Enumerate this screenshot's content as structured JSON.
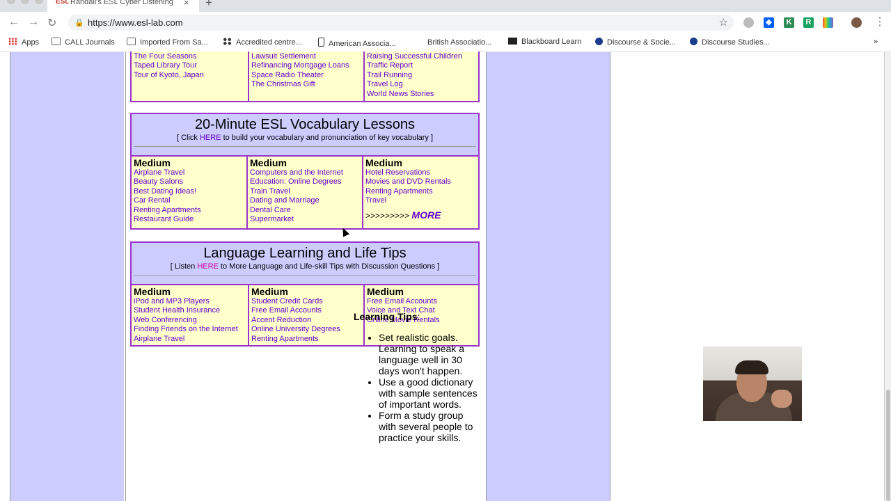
{
  "browser": {
    "tab_title": "Randall's ESL Cyber Listening",
    "tab_favicon": "ESL",
    "url": "https://www.esl-lab.com",
    "bookmarks": [
      "Apps",
      "CALL Journals",
      "Imported From Sa...",
      "Accredited centre...",
      "American Associa...",
      "British Associatio...",
      "Blackboard Learn",
      "Discourse & Socie...",
      "Discourse Studies..."
    ],
    "bookmarks_overflow": "»"
  },
  "top_box": {
    "col1": [
      "The Four Seasons",
      "Taped Library Tour",
      "Tour of Kyoto, Japan"
    ],
    "col2": [
      "Lawsuit Settlement",
      "Refinancing Mortgage Loans",
      "Space Radio Theater",
      "The Christmas Gift"
    ],
    "col3": [
      "Raising Successful Children",
      "Traffic Report",
      "Trail Running",
      "Travel Log",
      "World News Stories"
    ]
  },
  "vocab": {
    "title": "20-Minute ESL Vocabulary Lessons",
    "sub_pre": "[ Click ",
    "sub_link": "HERE",
    "sub_post": " to build your vocabulary and pronunciation of key vocabulary ]",
    "level": "Medium",
    "col1": [
      "Airplane Travel",
      "Beauty Salons",
      "Best Dating Ideas!",
      "Car Rental",
      "Renting Apartments",
      "Restaurant Guide"
    ],
    "col2": [
      "Computers and the Internet",
      "Education: Online Degrees",
      "Train Travel",
      "Dating and Marriage",
      "Dental Care",
      "Supermarket"
    ],
    "col3": [
      "Hotel Reservations",
      "Movies and DVD Rentals",
      "Renting Apartments",
      "Travel"
    ],
    "more_arrows": ">>>>>>>>>",
    "more_label": "MORE"
  },
  "tips_box": {
    "title": "Language Learning and Life Tips",
    "sub_pre": "[ Listen ",
    "sub_link": "HERE",
    "sub_post": " to More Language and Life-skill Tips with Discussion Questions ]",
    "level": "Medium",
    "col1": [
      "iPod and MP3 Players",
      "Student Health Insurance",
      "Web Conferencing",
      "Finding Friends on the Internet",
      "Airplane Travel"
    ],
    "col2": [
      "Student Credit Cards",
      "Free Email Accounts",
      "Accent Reduction",
      "Online University Degrees",
      "Renting Apartments"
    ],
    "col3": [
      "Free Email Accounts",
      "Voice and Text Chat",
      "Online Movie Rentals"
    ]
  },
  "learning_tips": {
    "title": "Learning Tips",
    "colon": ":",
    "items": [
      "Set realistic goals. Learning to speak a language well in 30 days won't happen.",
      "Use a good dictionary with sample sentences of important words.",
      "Form a study group with several people to practice your skills."
    ]
  },
  "colors": {
    "link": "#6600cc",
    "here_pink": "#cc0099",
    "border": "#9933cc",
    "box_bg": "#ffffcc",
    "side_bg": "#ccccff"
  }
}
